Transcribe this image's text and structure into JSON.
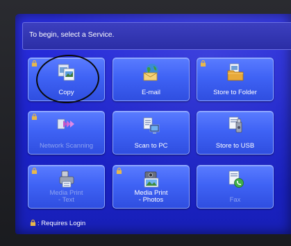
{
  "header": {
    "instruction": "To begin, select a Service."
  },
  "services": [
    {
      "label": "Copy",
      "icon": "copy-icon",
      "login_required": true,
      "enabled": true
    },
    {
      "label": "E-mail",
      "icon": "email-icon",
      "login_required": false,
      "enabled": true
    },
    {
      "label": "Store to Folder",
      "icon": "store-to-folder-icon",
      "login_required": true,
      "enabled": true
    },
    {
      "label": "Network Scanning",
      "icon": "network-scanning-icon",
      "login_required": true,
      "enabled": false
    },
    {
      "label": "Scan to PC",
      "icon": "scan-to-pc-icon",
      "login_required": false,
      "enabled": true
    },
    {
      "label": "Store to USB",
      "icon": "store-to-usb-icon",
      "login_required": false,
      "enabled": true
    },
    {
      "label": "Media Print - Text",
      "label_lines": [
        "Media Print",
        "- Text"
      ],
      "icon": "media-print-text-icon",
      "login_required": true,
      "enabled": false
    },
    {
      "label": "Media Print - Photos",
      "label_lines": [
        "Media Print",
        "- Photos"
      ],
      "icon": "media-print-photos-icon",
      "login_required": true,
      "enabled": true
    },
    {
      "label": "Fax",
      "icon": "fax-icon",
      "login_required": false,
      "enabled": false
    }
  ],
  "footer": {
    "legend": ": Requires Login"
  },
  "colors": {
    "screen_bg": "#1b22c8",
    "tile_bg": "#3f63f5",
    "tile_border": "#8aa4ff",
    "dim_label": "#8ea3f0",
    "lock_badge": "#e8b84a"
  }
}
